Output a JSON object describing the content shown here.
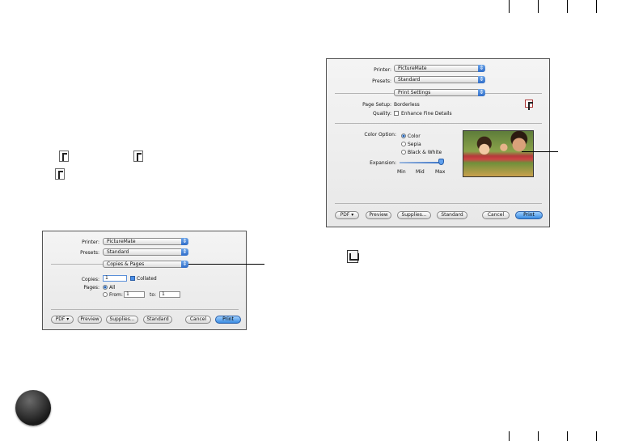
{
  "dialog1": {
    "printer_label": "Printer:",
    "printer_value": "PictureMate",
    "presets_label": "Presets:",
    "presets_value": "Standard",
    "panel_value": "Copies & Pages",
    "copies_label": "Copies:",
    "copies_value": "1",
    "collated_label": "Collated",
    "pages_label": "Pages:",
    "all_label": "All",
    "from_label": "From:",
    "from_value": "1",
    "to_label": "to:",
    "to_value": "1",
    "buttons": {
      "pdf": "PDF ▾",
      "preview": "Preview",
      "supplies": "Supplies...",
      "standard": "Standard",
      "cancel": "Cancel",
      "print": "Print"
    }
  },
  "dialog2": {
    "printer_label": "Printer:",
    "printer_value": "PictureMate",
    "presets_label": "Presets:",
    "presets_value": "Standard",
    "panel_value": "Print Settings",
    "page_setup_label": "Page Setup:",
    "page_setup_value": "Borderless",
    "quality_label": "Quality:",
    "enhance_label": "Enhance Fine Details",
    "color_option_label": "Color Option:",
    "color_options": [
      "Color",
      "Sepia",
      "Black & White"
    ],
    "expansion_label": "Expansion:",
    "expansion_min": "Min",
    "expansion_mid": "Mid",
    "expansion_max": "Max",
    "expansion_level": "Max",
    "buttons": {
      "pdf": "PDF ▾",
      "preview": "Preview",
      "supplies": "Supplies...",
      "standard": "Standard",
      "cancel": "Cancel",
      "print": "Print"
    }
  },
  "icons": [
    "page-icon",
    "page-orientation-icon",
    "page-orientation-icon",
    "print-settings-icon",
    "utility-icon"
  ]
}
